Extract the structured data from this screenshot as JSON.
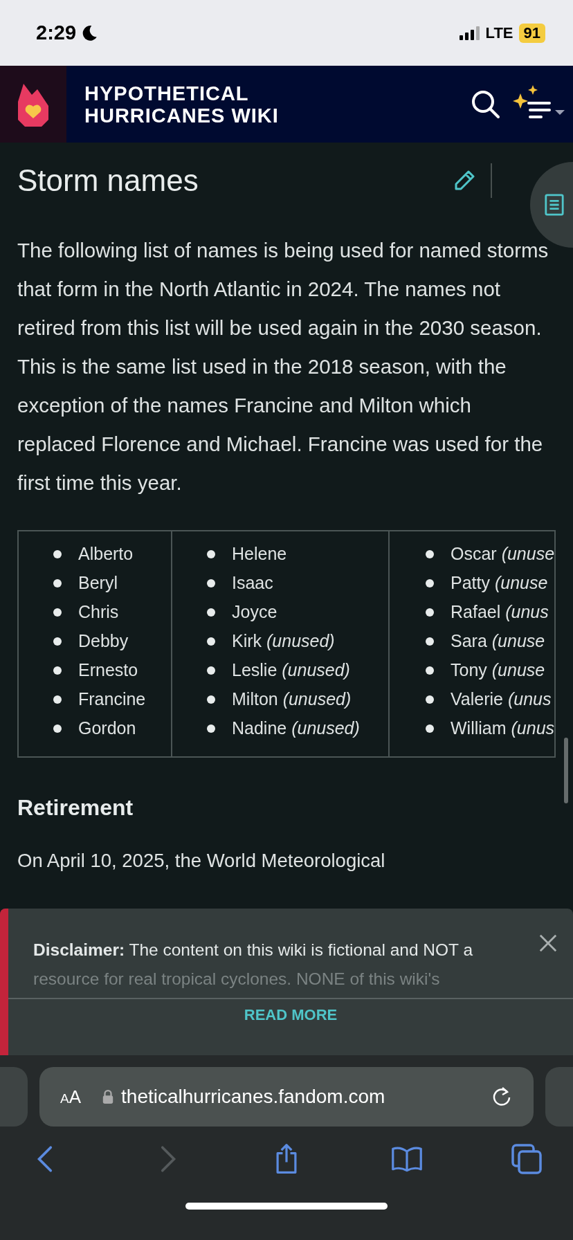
{
  "status_bar": {
    "time": "2:29",
    "network": "LTE",
    "battery": "91"
  },
  "header": {
    "title": "HYPOTHETICAL HURRICANES WIKI"
  },
  "article": {
    "title": "Storm names",
    "paragraph": "The following list of names is being used for named storms that form in the North Atlantic in 2024. The names not retired from this list will be used again in the 2030 season. This is the same list used in the 2018 season, with the exception of the names Francine and Milton which replaced Florence and Michael. Francine was used for the first time this year.",
    "table": {
      "columns": [
        [
          "Alberto",
          "Beryl",
          "Chris",
          "Debby",
          "Ernesto",
          "Francine",
          "Gordon"
        ],
        [
          "Helene",
          "Isaac",
          "Joyce",
          "Kirk *(unused)*",
          "Leslie *(unused)*",
          "Milton *(unused)*",
          "Nadine *(unused)*"
        ],
        [
          "Oscar *(unuse*",
          "Patty *(unuse*",
          "Rafael *(unus*",
          "Sara *(unuse*",
          "Tony *(unuse*",
          "Valerie *(unus*",
          "William *(unus*"
        ]
      ]
    },
    "section_heading": "Retirement",
    "paragraph_2": "On April 10, 2025, the World Meteorological"
  },
  "disclaimer": {
    "text": "**Disclaimer:** The content on this wiki is fictional and NOT a",
    "text_faded": "resource for real tropical cyclones. NONE of this wiki's",
    "action": "READ MORE"
  },
  "browser": {
    "text_size": "AA",
    "url": "theticalhurricanes.fandom.com"
  }
}
